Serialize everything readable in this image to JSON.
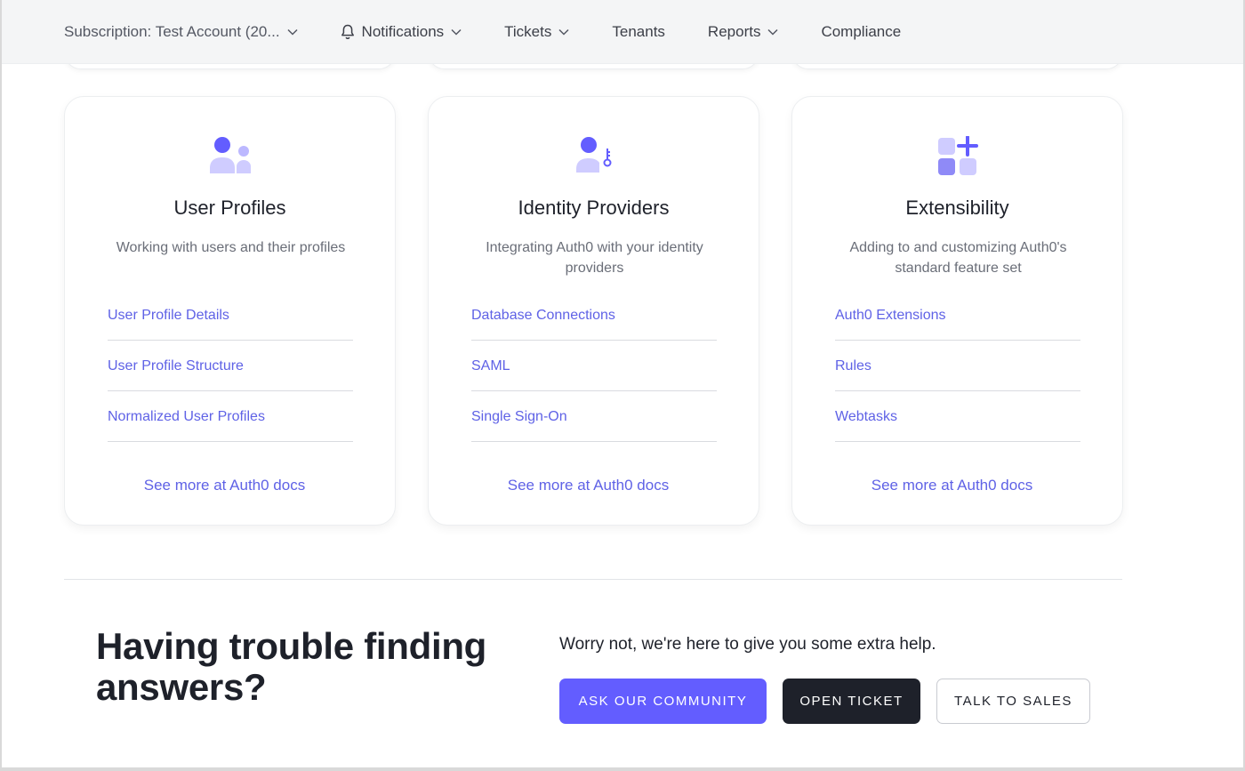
{
  "nav": {
    "subscription": "Subscription: Test Account (20...",
    "notifications": "Notifications",
    "tickets": "Tickets",
    "tenants": "Tenants",
    "reports": "Reports",
    "compliance": "Compliance"
  },
  "cards": [
    {
      "icon": "users-icon",
      "title": "User Profiles",
      "desc": "Working with users and their profiles",
      "links": [
        "User Profile Details",
        "User Profile Structure",
        "Normalized User Profiles"
      ],
      "more": "See more at Auth0 docs"
    },
    {
      "icon": "user-key-icon",
      "title": "Identity Providers",
      "desc": "Integrating Auth0 with your identity providers",
      "links": [
        "Database Connections",
        "SAML",
        "Single Sign-On"
      ],
      "more": "See more at Auth0 docs"
    },
    {
      "icon": "extensions-icon",
      "title": "Extensibility",
      "desc": "Adding to and customizing Auth0's standard feature set",
      "links": [
        "Auth0 Extensions",
        "Rules",
        "Webtasks"
      ],
      "more": "See more at Auth0 docs"
    }
  ],
  "help": {
    "heading": "Having trouble finding answers?",
    "text": "Worry not, we're here to give you some extra help.",
    "community_btn": "ASK OUR COMMUNITY",
    "ticket_btn": "OPEN TICKET",
    "sales_btn": "TALK TO SALES"
  },
  "colors": {
    "accent": "#635dff",
    "link": "#5f62e6",
    "dark": "#1e212a"
  }
}
